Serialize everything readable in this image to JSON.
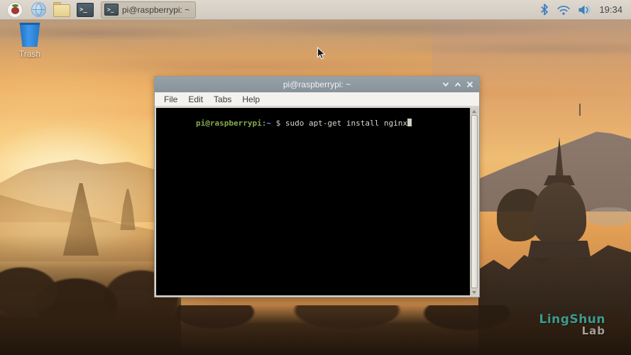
{
  "taskbar": {
    "task_button_label": "pi@raspberrypi: ~",
    "clock": "19:34"
  },
  "desktop": {
    "trash_label": "Trash",
    "watermark_line1": "LingShun",
    "watermark_line2": "Lab"
  },
  "window": {
    "title": "pi@raspberrypi: ~",
    "menu": [
      "File",
      "Edit",
      "Tabs",
      "Help"
    ],
    "terminal": {
      "user_host": "pi@raspberrypi",
      "colon": ":",
      "path": "~",
      "prompt_symbol": " $ ",
      "command": "sudo apt-get install nginx"
    }
  },
  "icons": {
    "menu": "raspberry-icon",
    "browser": "globe-icon",
    "files": "folder-icon",
    "terminal": "terminal-icon",
    "bluetooth": "bluetooth-icon",
    "network": "wifi-icon",
    "volume": "speaker-icon",
    "minimize": "chevron-down-icon",
    "maximize": "chevron-up-icon",
    "close": "x-icon",
    "trash": "trash-icon"
  },
  "colors": {
    "taskbar_bg": "#d5cec4",
    "titlebar_bg": "#8e979d",
    "terminal_bg": "#000000",
    "prompt_green": "#85ab50",
    "prompt_blue": "#7291c9",
    "terminal_text": "#d8d8cf",
    "tray_icon_blue": "#3a7fc1",
    "watermark_teal": "#3d9a8e"
  }
}
